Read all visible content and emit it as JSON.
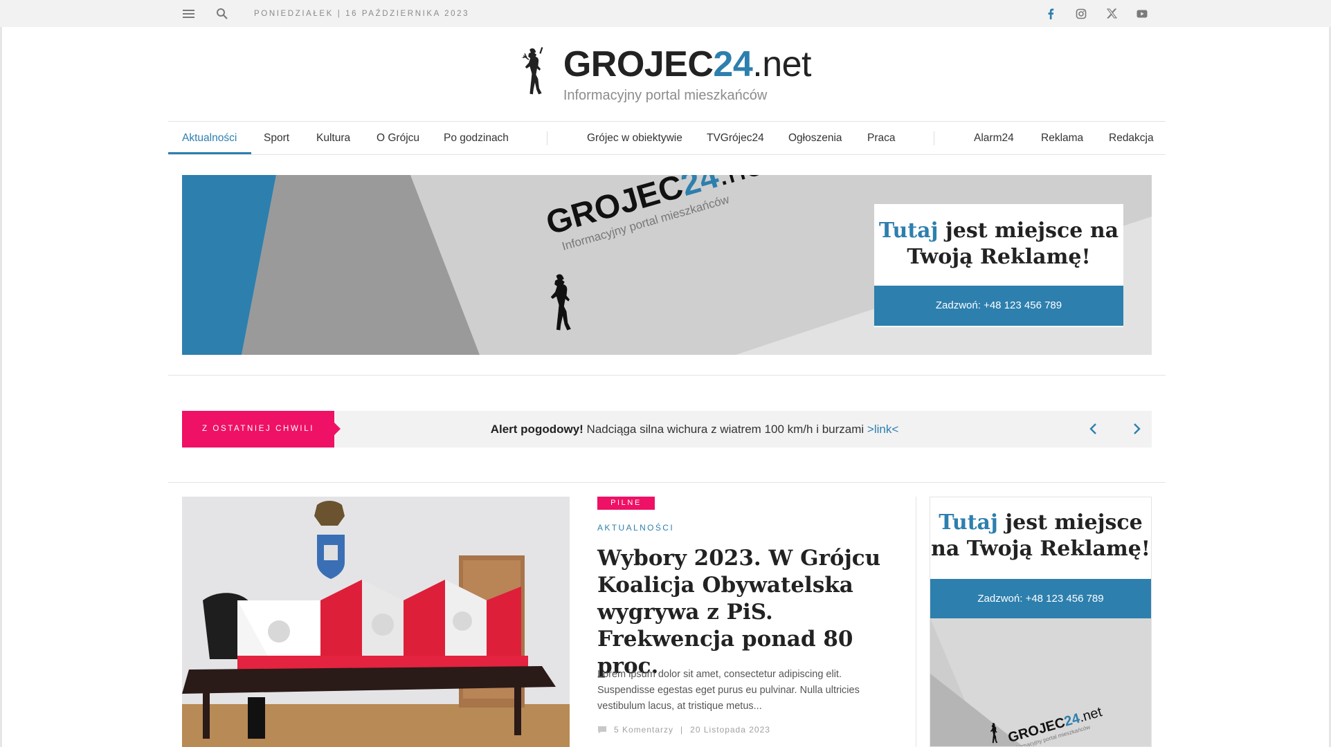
{
  "topbar": {
    "date": "PONIEDZIAŁEK  |  16 PAŹDZIERNIKA 2023",
    "social": [
      "facebook-icon",
      "instagram-icon",
      "x-icon",
      "youtube-icon"
    ]
  },
  "logo": {
    "main_a": "GROJEC",
    "main_num": "24",
    "main_net": ".net",
    "subtitle": "Informacyjny portal mieszkańców"
  },
  "nav": {
    "items": [
      "Aktualności",
      "Sport",
      "Kultura",
      "O Grójcu",
      "Po godzinach",
      "Grójec w obiektywie",
      "TVGrójec24",
      "Ogłoszenia",
      "Praca",
      "Alarm24",
      "Reklama",
      "Redakcja"
    ],
    "active": "Aktualności"
  },
  "banner": {
    "title_hl": "Tutaj",
    "title_rest_1": " jest miejsce na",
    "title_line2": "Twoją Reklamę!",
    "cta": "Zadzwoń: +48 123 456 789",
    "logo_a": "GROJEC",
    "logo_num": "24",
    "logo_net": ".net",
    "logo_sub": "Informacyjny portal mieszkańców"
  },
  "ticker": {
    "label": "Z OSTATNIEJ CHWILI",
    "bold": "Alert pogodowy!",
    "text": " Nadciąga silna wichura z wiatrem 100 km/h i burzami ",
    "link": ">link<"
  },
  "article": {
    "badge": "PILNE",
    "category": "AKTUALNOŚCI",
    "headline": "Wybory 2023. W Grójcu Koalicja Obywatelska wygrywa z PiS. Frekwencja ponad 80 proc.",
    "excerpt": "Lorem ipsum dolor sit amet, consectetur adipiscing elit. Suspendisse egestas eget purus eu pulvinar. Nulla ultricies vestibulum lacus, at tristique metus...",
    "comments": "5 Komentarzy",
    "meta_sep": "|",
    "date": "20 Listopada 2023"
  },
  "side_ad": {
    "title_hl": "Tutaj",
    "title_rest_1": " jest miejsce",
    "title_line2": "na Twoją Reklamę!",
    "cta": "Zadzwoń: +48 123 456 789",
    "logo_a": "GROJEC",
    "logo_num": "24",
    "logo_net": ".net",
    "logo_sub": "Informacyjny portal mieszkańców"
  },
  "colors": {
    "accent": "#2d7fae",
    "alert": "#ee1166",
    "topbar_bg": "#f2f2f2"
  }
}
